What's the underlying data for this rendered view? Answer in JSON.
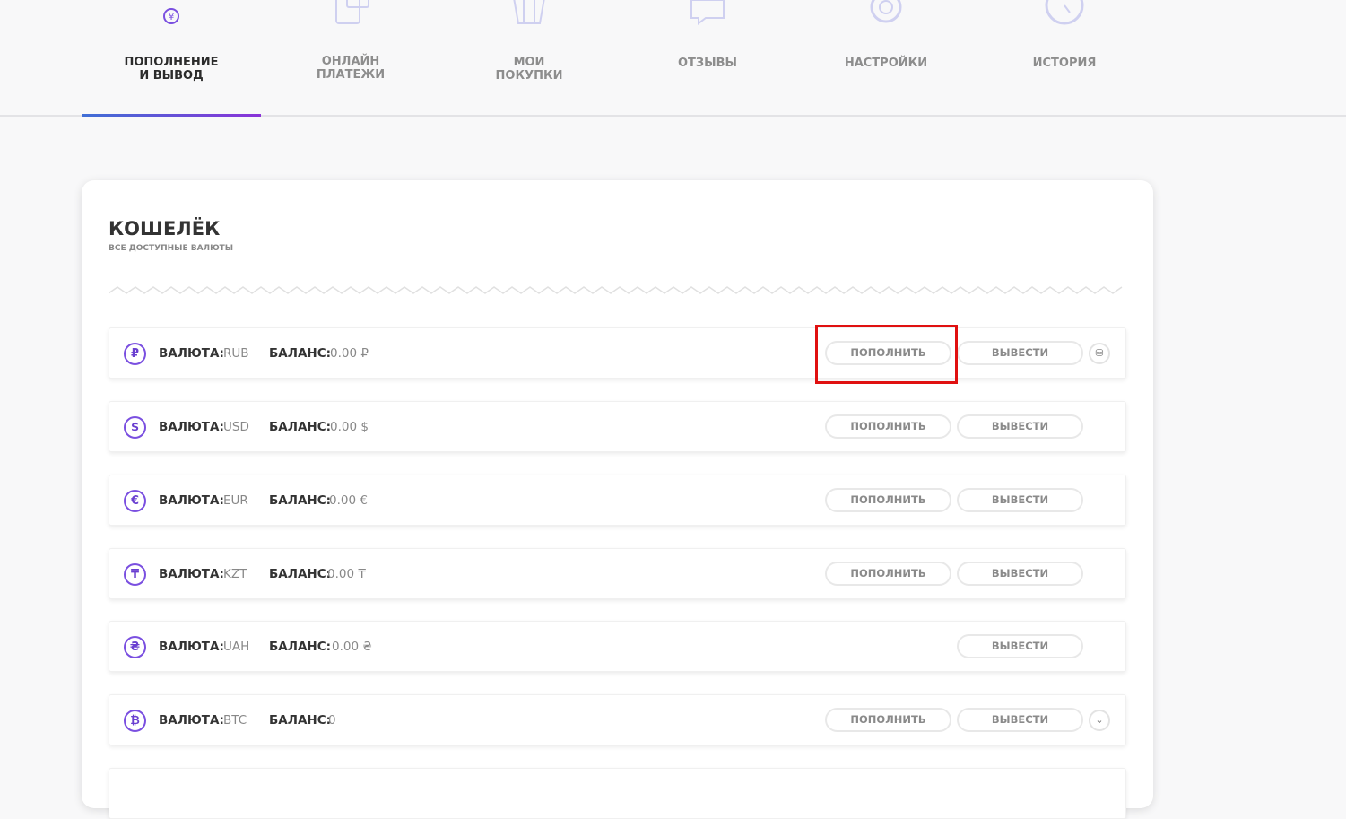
{
  "tabs": [
    {
      "label1": "ПОПОЛНЕНИЕ",
      "label2": "И ВЫВОД",
      "icon": "coins-icon",
      "active": true
    },
    {
      "label1": "ОНЛАЙН",
      "label2": "ПЛАТЕЖИ",
      "icon": "cards-icon"
    },
    {
      "label1": "МОИ",
      "label2": "ПОКУПКИ",
      "icon": "basket-icon"
    },
    {
      "label1": "ОТЗЫВЫ",
      "label2": "",
      "icon": "chat-icon"
    },
    {
      "label1": "НАСТРОЙКИ",
      "label2": "",
      "icon": "gear-icon"
    },
    {
      "label1": "ИСТОРИЯ",
      "label2": "",
      "icon": "clock-icon"
    }
  ],
  "wallet": {
    "title": "КОШЕЛЁК",
    "subtitle": "ВСЕ ДОСТУПНЫЕ ВАЛЮТЫ",
    "currency_label": "ВАЛЮТА:",
    "balance_label": "БАЛАНС:",
    "deposit": "ПОПОЛНИТЬ",
    "withdraw": "ВЫВЕСТИ",
    "rows": [
      {
        "symbol": "₽",
        "code": "RUB",
        "balance": "0.00 ₽"
      },
      {
        "symbol": "$",
        "code": "USD",
        "balance": "0.00 $"
      },
      {
        "symbol": "€",
        "code": "EUR",
        "balance": "0.00 €"
      },
      {
        "symbol": "₸",
        "code": "KZT",
        "balance": "0.00 ₸"
      },
      {
        "symbol": "₴",
        "code": "UAH",
        "balance": "0.00 ₴"
      },
      {
        "symbol": "₿",
        "code": "BTC",
        "balance": "0"
      }
    ]
  },
  "colors": {
    "accent": "#7a4fe0",
    "highlight": "#e01010"
  }
}
